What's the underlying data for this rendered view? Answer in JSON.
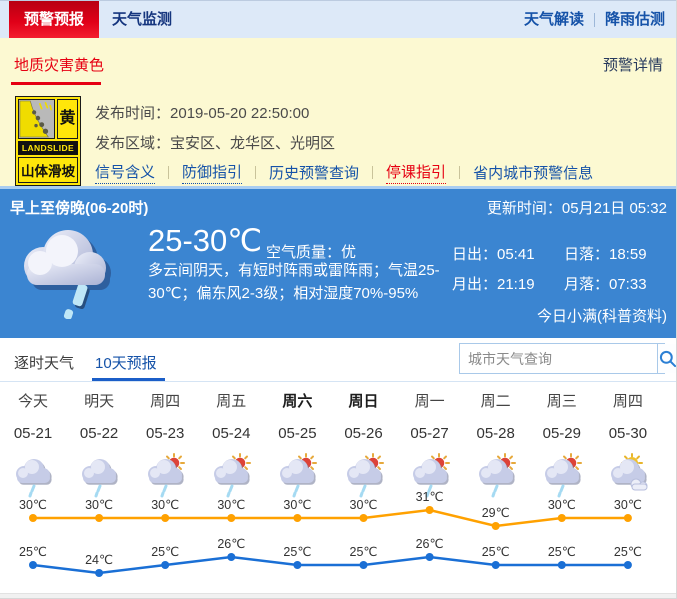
{
  "topbar": {
    "tabs": [
      {
        "label": "预警预报",
        "active": true
      },
      {
        "label": "天气监测",
        "active": false
      }
    ],
    "links": [
      "天气解读",
      "降雨估测"
    ]
  },
  "warning": {
    "type_label": "地质灾害黄色",
    "detail_link": "预警详情",
    "icon": {
      "level": "黄",
      "en": "LANDSLIDE",
      "name": "山体滑坡"
    },
    "publish_time_label": "发布时间：",
    "publish_time": "2019-05-20 22:50:00",
    "area_label": "发布区域：",
    "area": "宝安区、龙华区、光明区",
    "links": [
      {
        "label": "信号含义",
        "style": "blue"
      },
      {
        "label": "防御指引",
        "style": "blue"
      },
      {
        "label": "历史预警查询",
        "style": "blue nounder"
      },
      {
        "label": "停课指引",
        "style": "red"
      },
      {
        "label": "省内城市预警信息",
        "style": "blue nounder"
      }
    ]
  },
  "current": {
    "period": "早上至傍晚(06-20时)",
    "update_label": "更新时间：",
    "update_time": "05月21日 05:32",
    "temp_range": "25-30℃",
    "air_quality_label": "空气质量：",
    "air_quality": "优",
    "description": "多云间阴天，有短时阵雨或雷阵雨；气温25-30℃；偏东风2-3级；相对湿度70%-95%",
    "sunrise": "日出：05:41",
    "sunset": "日落：18:59",
    "moonrise": "月出：21:19",
    "moonset": "月落：07:33",
    "solar_term": "今日小满(科普资料)",
    "weather_icon": "cloud-rain-icon"
  },
  "forecast_tabs": {
    "hourly": "逐时天气",
    "ten_day": "10天预报",
    "search_placeholder": "城市天气查询",
    "search_icon": "search-icon"
  },
  "chart_data": {
    "type": "line",
    "categories": [
      "今天",
      "明天",
      "周四",
      "周五",
      "周六",
      "周日",
      "周一",
      "周二",
      "周三",
      "周四"
    ],
    "dates": [
      "05-21",
      "05-22",
      "05-23",
      "05-24",
      "05-25",
      "05-26",
      "05-27",
      "05-28",
      "05-29",
      "05-30"
    ],
    "icons": [
      "rain",
      "rain",
      "sun-rain",
      "sun-rain",
      "sun-rain",
      "sun-rain",
      "sun-rain",
      "sun-rain",
      "sun-rain",
      "sun-cloud"
    ],
    "weekend_bold": [
      4,
      5
    ],
    "unit": "℃",
    "series": [
      {
        "name": "high",
        "color": "#ffa100",
        "values": [
          30,
          30,
          30,
          30,
          30,
          30,
          31,
          29,
          30,
          30
        ]
      },
      {
        "name": "low",
        "color": "#1a6fd5",
        "values": [
          25,
          24,
          25,
          26,
          25,
          25,
          26,
          25,
          25,
          25
        ]
      }
    ],
    "legend": "none",
    "grid": false
  },
  "colors": {
    "accent_red": "#e60012",
    "accent_blue": "#1552a8",
    "panel_blue": "#3b85d1",
    "warning_bg": "#fcf9d2",
    "topbar_bg": "#dde9f8",
    "high_line": "#ffa100",
    "low_line": "#1a6fd5"
  }
}
